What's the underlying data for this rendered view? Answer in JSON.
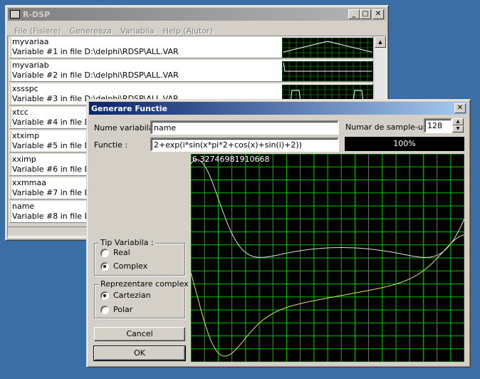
{
  "main_window": {
    "title": "R-DSP",
    "menu": [
      "File (Fisiere)",
      "Genereaza",
      "Variabila",
      "Help (Ajutor)"
    ],
    "variables": [
      {
        "name": "myvariaa",
        "desc": "Variable #1 in file D:\\delphi\\RDSP\\ALL.VAR"
      },
      {
        "name": "myvariab",
        "desc": "Variable #2 in file D:\\delphi\\RDSP\\ALL.VAR"
      },
      {
        "name": "xssspc",
        "desc": "Variable #3 in file D:\\delphi\\RDSP\\ALL.VAR"
      },
      {
        "name": "xtcc",
        "desc": "Variable #4 in file D:\\delphi\\RDSP\\ALL.VAR"
      },
      {
        "name": "xtximp",
        "desc": "Variable #5 in file D:\\delphi\\RDSP\\ALL.VAR"
      },
      {
        "name": "xximp",
        "desc": "Variable #6 in file D:\\delphi\\RDSP\\ALL.VAR"
      },
      {
        "name": "xxmmaa",
        "desc": "Variable #7 in file D:\\delphi\\RDSP\\ALL.VAR"
      },
      {
        "name": "name",
        "desc": "Variable #8 in file D:\\delphi\\RDSP\\ALL.VAR"
      }
    ]
  },
  "dialog": {
    "title": "Generare Functie",
    "name_label": "Nume variabila :",
    "name_value": "name",
    "samples_label": "Numar de sample-uri :",
    "samples_value": "128",
    "function_label": "Functie :",
    "function_value": "2+exp(i*sin(x*pi*2+cos(x)+sin(i)+2))",
    "progress_text": "100%",
    "progress": 1.0,
    "plot_value_label": "6.32746981910668",
    "tip_group": {
      "legend": "Tip Variabila :",
      "options": [
        "Real",
        "Complex"
      ],
      "selected": 1
    },
    "repr_group": {
      "legend": "Reprezentare complex :",
      "options": [
        "Cartezian",
        "Polar"
      ],
      "selected": 0
    },
    "cancel_label": "Cancel",
    "ok_label": "OK"
  },
  "colors": {
    "desktop": "#3a6ea5",
    "grid": "#00c000",
    "curve_real": "#e0e0e0",
    "curve_imag": "#e6e65a",
    "active_title": "#0a246a"
  }
}
